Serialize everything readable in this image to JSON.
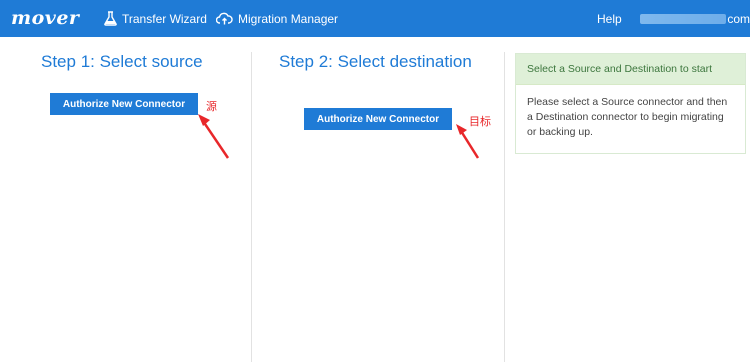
{
  "header": {
    "logo": "mover",
    "nav": {
      "transfer_label": "Transfer Wizard",
      "migration_label": "Migration Manager",
      "help_label": "Help"
    },
    "user_email_suffix": "com"
  },
  "step1": {
    "title": "Step 1: Select source",
    "button_label": "Authorize New Connector",
    "annotation": "源"
  },
  "step2": {
    "title": "Step 2: Select destination",
    "button_label": "Authorize New Connector",
    "annotation": "目标"
  },
  "info_panel": {
    "heading": "Select a Source and Destination to start",
    "body": "Please select a Source connector and then a Destination connector to begin migrating or backing up."
  },
  "colors": {
    "brand_blue": "#1f7bd6",
    "annotation_red": "#e8272a",
    "panel_green_bg": "#dff0d8",
    "panel_green_text": "#3c763d"
  },
  "icons": [
    "flask-icon",
    "cloud-upload-icon"
  ]
}
